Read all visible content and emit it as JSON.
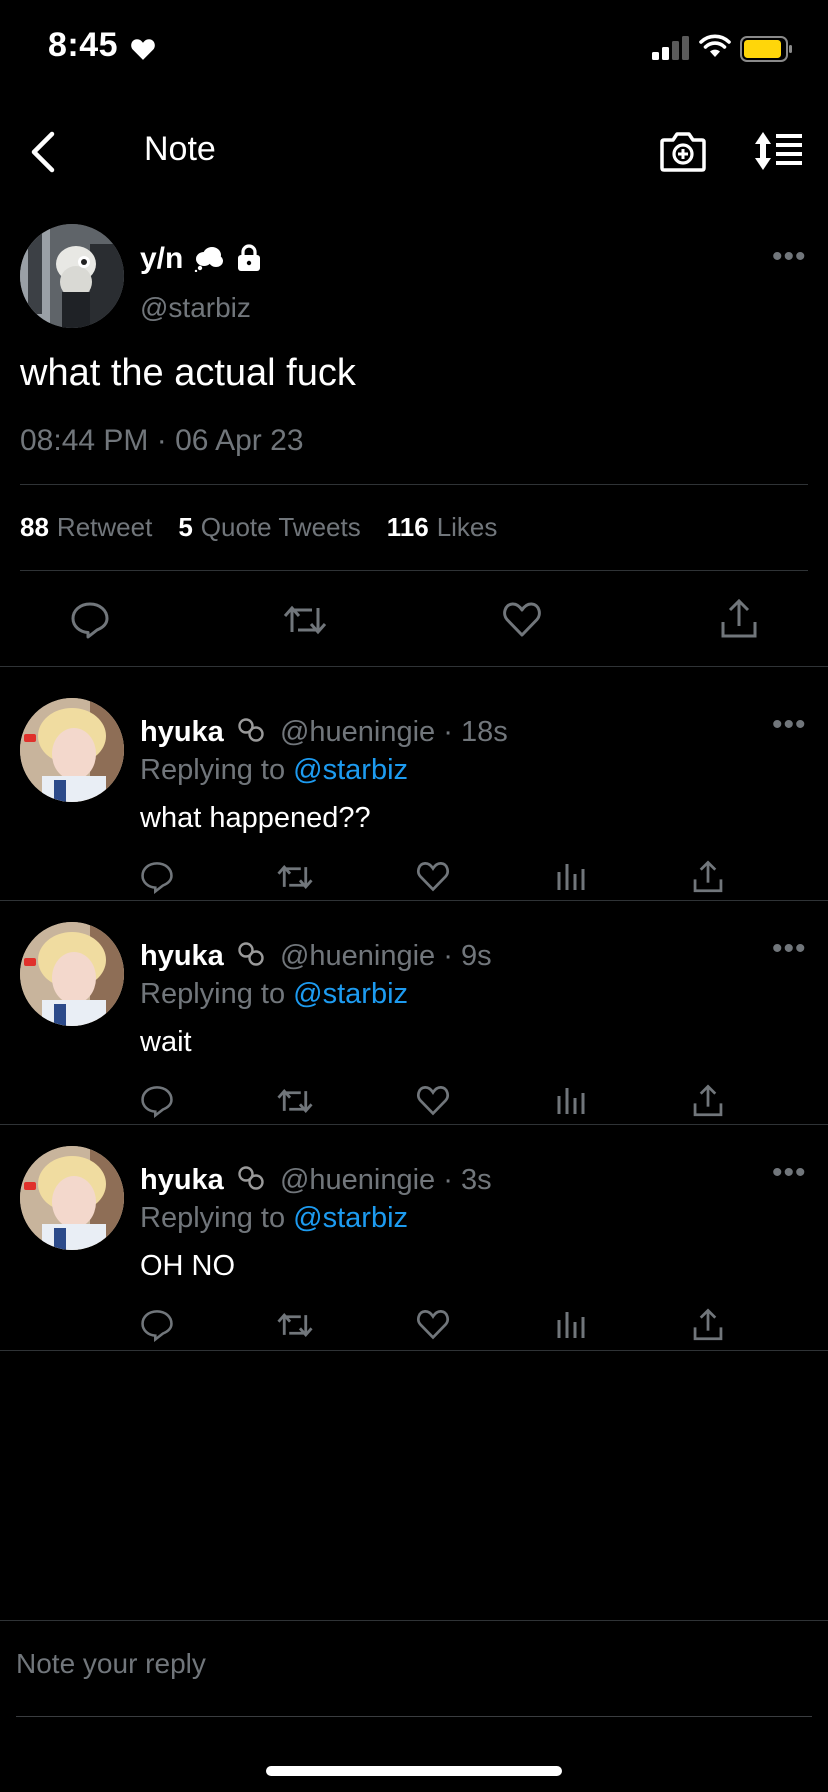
{
  "status_bar": {
    "time": "8:45"
  },
  "nav": {
    "title": "Note"
  },
  "tweet": {
    "name": "y/n",
    "handle": "@starbiz",
    "text": "what the actual fuck",
    "timestamp": "08:44 PM · 06 Apr 23",
    "retweet_count": "88",
    "retweet_label": "Retweet",
    "quote_count": "5",
    "quote_label": "Quote Tweets",
    "like_count": "116",
    "like_label": "Likes",
    "more": "•••"
  },
  "replies": [
    {
      "name": "hyuka",
      "handle": "@hueningie",
      "time": "· 18s",
      "replying_prefix": "Replying to",
      "replying_to": "@starbiz",
      "text": "what happened??",
      "more": "•••"
    },
    {
      "name": "hyuka",
      "handle": "@hueningie",
      "time": "· 9s",
      "replying_prefix": "Replying to",
      "replying_to": "@starbiz",
      "text": "wait",
      "more": "•••"
    },
    {
      "name": "hyuka",
      "handle": "@hueningie",
      "time": "· 3s",
      "replying_prefix": "Replying to",
      "replying_to": "@starbiz",
      "text": "OH NO",
      "more": "•••"
    }
  ],
  "reply_box": {
    "placeholder": "Note your reply"
  },
  "colors": {
    "background": "#000000",
    "secondary_text": "#71767b",
    "link": "#1d9bf0",
    "divider": "#2f3336",
    "battery": "#ffd60a"
  }
}
